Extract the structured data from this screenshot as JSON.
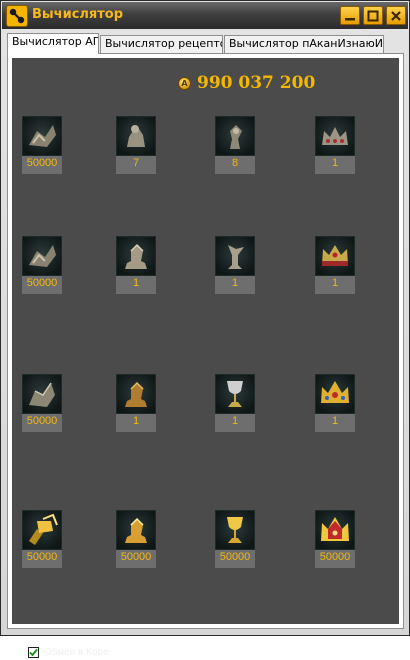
{
  "window": {
    "title": "Вычислятор"
  },
  "tabs": [
    {
      "label": "Вычислятор АП"
    },
    {
      "label": "Вычислятор рецептов"
    },
    {
      "label": "Вычислятор пАканИзнаюИго"
    }
  ],
  "balance": {
    "value": "990 037 200",
    "icon": "gold-coin-icon"
  },
  "grid": {
    "rows": [
      {
        "items": [
          {
            "icon": "rune-fragment-icon",
            "qty": "50000"
          },
          {
            "icon": "rough-idol-icon",
            "qty": "7"
          },
          {
            "icon": "rough-relic-icon",
            "qty": "8"
          },
          {
            "icon": "rough-crown-icon",
            "qty": "1"
          }
        ]
      },
      {
        "items": [
          {
            "icon": "rune-fragment-icon",
            "qty": "50000"
          },
          {
            "icon": "stone-idol-icon",
            "qty": "1"
          },
          {
            "icon": "stone-relic-icon",
            "qty": "1"
          },
          {
            "icon": "stone-crown-icon",
            "qty": "1"
          }
        ]
      },
      {
        "items": [
          {
            "icon": "rune-fragment-icon",
            "qty": "50000"
          },
          {
            "icon": "bronze-idol-icon",
            "qty": "1"
          },
          {
            "icon": "silver-goblet-icon",
            "qty": "1"
          },
          {
            "icon": "gold-crown-icon",
            "qty": "1"
          }
        ]
      },
      {
        "items": [
          {
            "icon": "gold-hammer-icon",
            "qty": "50000"
          },
          {
            "icon": "gold-idol-icon",
            "qty": "50000"
          },
          {
            "icon": "gold-goblet-icon",
            "qty": "50000"
          },
          {
            "icon": "jeweled-crown-icon",
            "qty": "50000"
          }
        ]
      }
    ]
  },
  "exchange_checkbox": {
    "label": "Обмен в Коре",
    "checked": true
  },
  "colors": {
    "accent": "#f5b800",
    "panel_bg": "#4b4b4b",
    "qty_bg": "#6e6e6e"
  }
}
